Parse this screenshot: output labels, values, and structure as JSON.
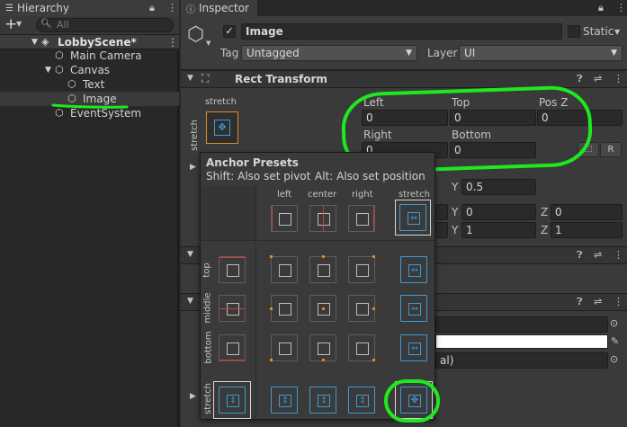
{
  "hierarchy": {
    "tab_label": "Hierarchy",
    "search_placeholder": "All",
    "items": [
      {
        "label": "LobbyScene*"
      },
      {
        "label": "Main Camera"
      },
      {
        "label": "Canvas"
      },
      {
        "label": "Text"
      },
      {
        "label": "Image"
      },
      {
        "label": "EventSystem"
      }
    ]
  },
  "inspector": {
    "tab_label": "Inspector",
    "object_name": "Image",
    "static_label": "Static",
    "tag_label": "Tag",
    "tag_value": "Untagged",
    "layer_label": "Layer",
    "layer_value": "UI",
    "rect_transform_title": "Rect Transform",
    "stretch_label": "stretch",
    "fields": {
      "left_label": "Left",
      "left_value": "0",
      "top_label": "Top",
      "top_value": "0",
      "posz_label": "Pos Z",
      "posz_value": "0",
      "right_label": "Right",
      "right_value": "0",
      "bottom_label": "Bottom",
      "bottom_value": "0",
      "r_button": "R"
    },
    "pivot_y_label": "Y",
    "pivot_y_value": "0.5",
    "rotation_y_label": "Y",
    "rotation_y_value": "0",
    "rotation_z_label": "Z",
    "rotation_z_value": "0",
    "scale_y_label": "Y",
    "scale_y_value": "1",
    "scale_z_label": "Z",
    "scale_z_value": "1",
    "material_partial": "al)"
  },
  "anchor_presets": {
    "title": "Anchor Presets",
    "shift_hint": "Shift: Also set pivot",
    "alt_hint": "Alt: Also set position",
    "columns": [
      "left",
      "center",
      "right",
      "stretch"
    ],
    "rows": [
      "top",
      "middle",
      "bottom",
      "stretch"
    ]
  },
  "colors": {
    "annotation": "#1ee81e",
    "accent": "#3d9ad6",
    "anchor_red": "#c7413f",
    "anchor_orange": "#e08a28"
  }
}
